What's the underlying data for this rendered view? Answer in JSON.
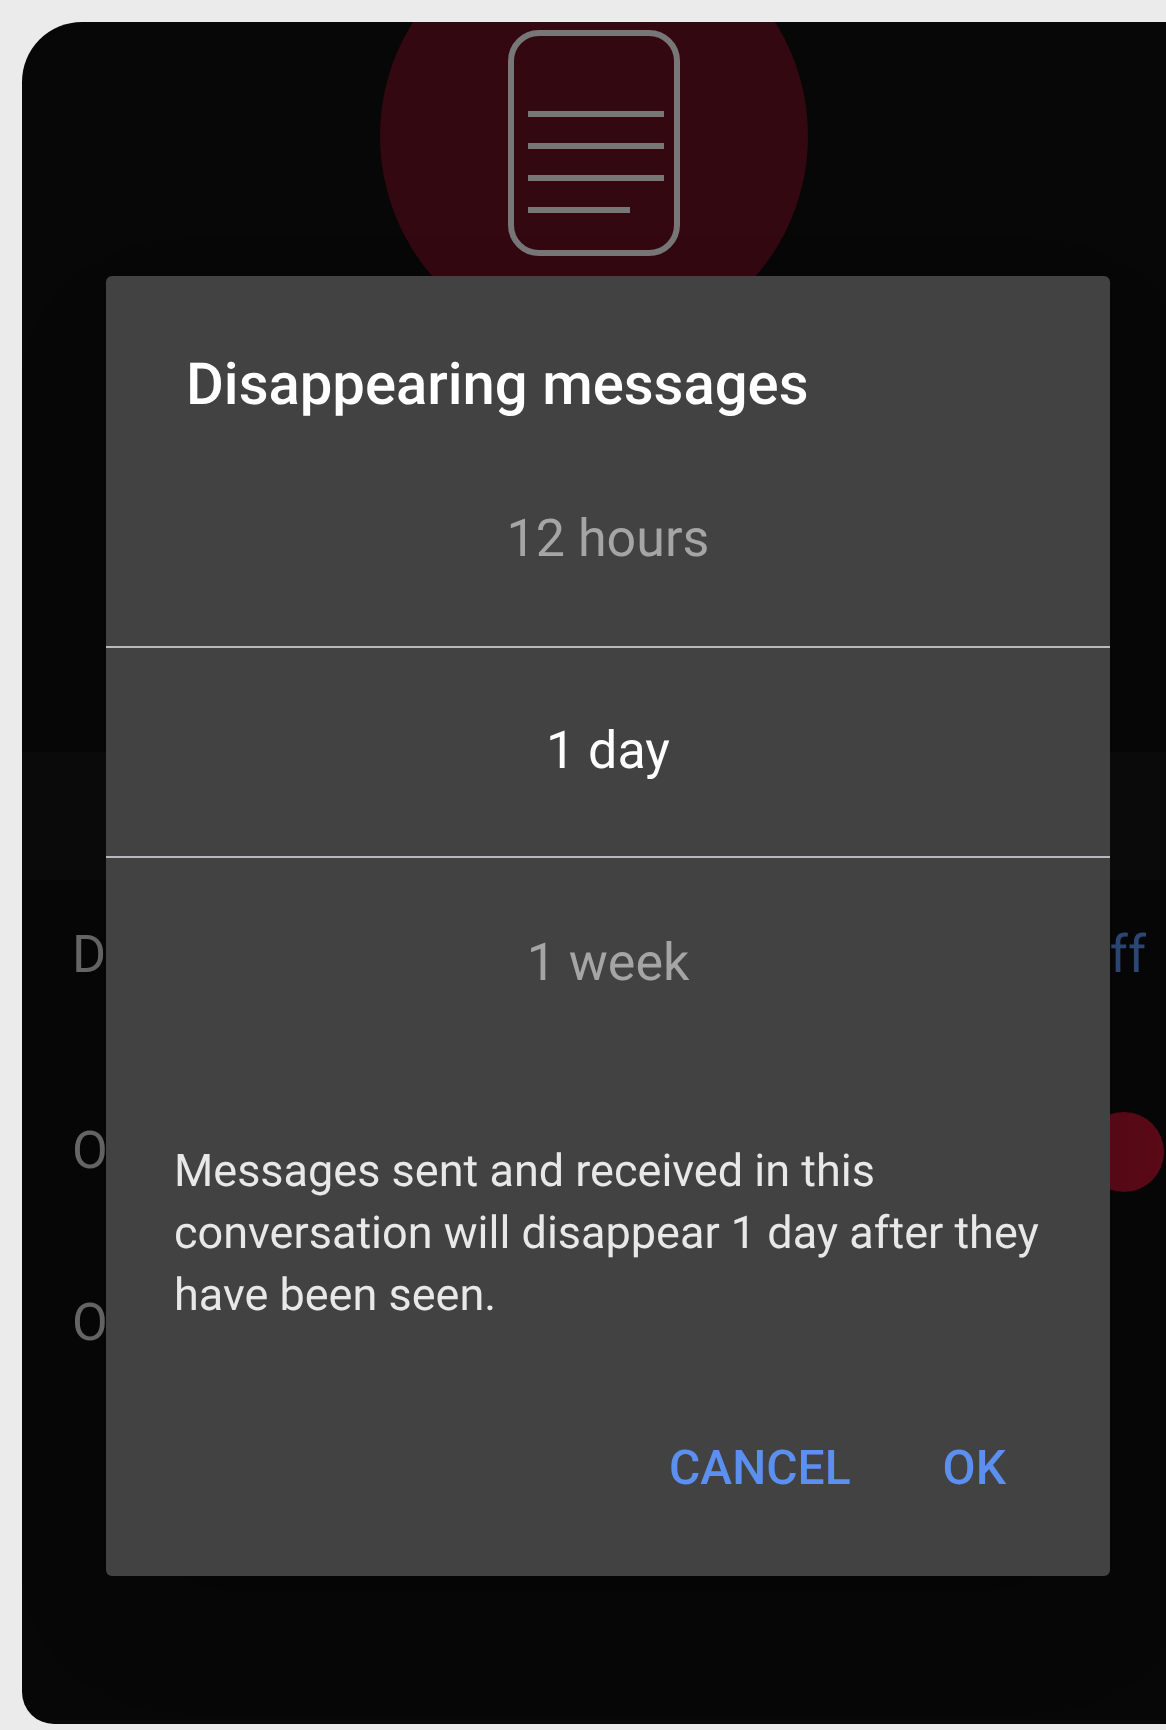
{
  "settings_rows": [
    {
      "label": "D",
      "value": "ff"
    },
    {
      "label": "O",
      "toggle_on": true
    },
    {
      "label": "O"
    }
  ],
  "dialog": {
    "title": "Disappearing messages",
    "options": [
      {
        "label": "12 hours",
        "selected": false
      },
      {
        "label": "1 day",
        "selected": true
      },
      {
        "label": "1 week",
        "selected": false
      }
    ],
    "description": "Messages sent and received in this conversation will disappear 1 day after they have been seen.",
    "buttons": [
      "CANCEL",
      "OK"
    ]
  }
}
